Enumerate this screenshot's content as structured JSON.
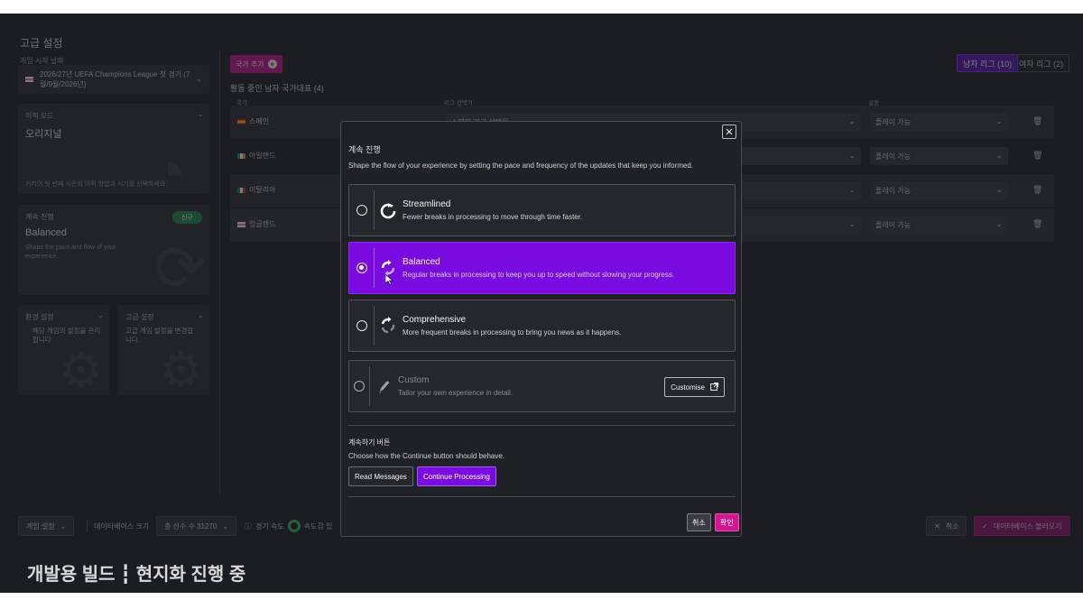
{
  "page": {
    "title": "고급 설정"
  },
  "left": {
    "start_date_label": "게임 시작 날짜",
    "start_date_value": "2026/27년 UEFA Champions League 첫 경기 (7월/9월/2026년)",
    "transfer": {
      "title": "이적 모드",
      "value": "오리지널",
      "desc": "커리어 첫 번째 시즌의 이적 방법과 시기를 선택하세요."
    },
    "pace": {
      "title": "계속 진행",
      "badge": "신규",
      "value": "Balanced",
      "desc": "Shape the pace and flow of your experience."
    },
    "env": {
      "title": "환경 설정",
      "desc": "해당 게임의 설정을 관리합니다"
    },
    "advanced": {
      "title": "고급 설정",
      "desc": "고급 게임 설정을 변경합니다."
    }
  },
  "main": {
    "add_button": "국가 추가",
    "men_tab": "남자 리그 (10)",
    "women_tab": "여자 리그 (2)",
    "section_title": "활동 중인 남자 국가대표 (4)",
    "col_country": "국가",
    "col_league": "리그 선택기",
    "col_setting": "설정",
    "rows": [
      {
        "country": "스페인",
        "league": "스페인 리그 선택됨",
        "setting": "플레이 가능"
      },
      {
        "country": "아일랜드",
        "league": "",
        "setting": "플레이 가능"
      },
      {
        "country": "이탈리아",
        "league": "",
        "setting": "플레이 가능"
      },
      {
        "country": "잉글랜드",
        "league": "",
        "setting": "플레이 가능"
      }
    ]
  },
  "bottom": {
    "game_settings": "게임 설정",
    "db_size_label": "데이터베이스 크기",
    "total_players": "총 선수 수 31270",
    "game_speed_label": "경기 속도",
    "speed_value": "속도감 있",
    "cancel": "취소",
    "load_db": "데이터베이스 불러오기"
  },
  "build_text": "개발용 빌드 ┇ 현지화 진행 중",
  "modal": {
    "title": "계속 진행",
    "desc": "Shape the flow of your experience by setting the pace and frequency of the updates that keep you informed.",
    "options": [
      {
        "name": "Streamlined",
        "desc": "Fewer breaks in processing to move through time faster.",
        "icon": "streamlined-icon",
        "selected": false
      },
      {
        "name": "Balanced",
        "desc": "Regular breaks in processing to keep you up to speed without slowing your progress.",
        "icon": "balanced-icon",
        "selected": true
      },
      {
        "name": "Comprehensive",
        "desc": "More frequent breaks in processing to bring you news as it happens.",
        "icon": "comprehensive-icon",
        "selected": false
      },
      {
        "name": "Custom",
        "desc": "Tailor your own experience in detail.",
        "icon": "pencil-icon",
        "selected": false
      }
    ],
    "customise_label": "Customise",
    "continue_title": "계속하기 버튼",
    "continue_desc": "Choose how the Continue button should behave.",
    "seg_read": "Read Messages",
    "seg_continue": "Continue Processing",
    "cancel": "취소",
    "confirm": "확인"
  },
  "colors": {
    "accent_purple": "#7a0be0",
    "accent_magenta": "#c8158f",
    "speed_ring": "#2fbf5a"
  }
}
